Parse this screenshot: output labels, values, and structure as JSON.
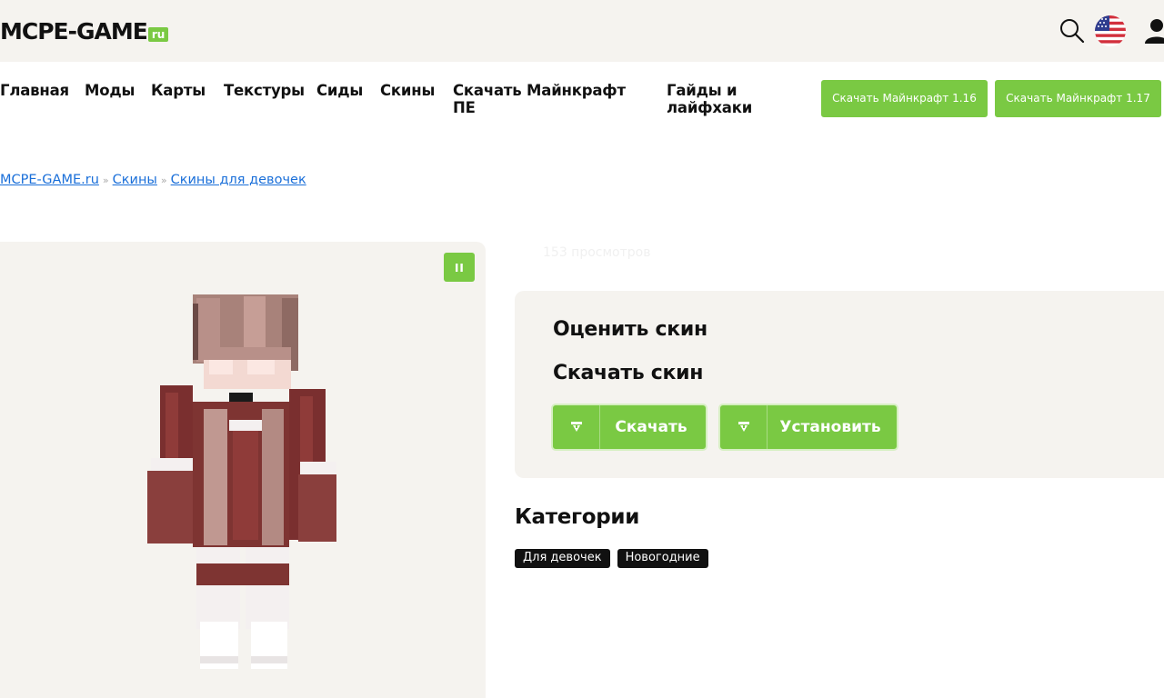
{
  "header": {
    "logo_main": "MCPE-GAME",
    "logo_suffix": "ru",
    "accent": "#7ac943"
  },
  "nav": {
    "items": [
      "Главная",
      "Моды",
      "Карты",
      "Текстуры",
      "Сиды",
      "Скины",
      "Скачать Майнкрафт ПЕ",
      "Гайды и лайфхаки"
    ],
    "cta_1": "Скачать Майнкрафт 1.16",
    "cta_2": "Скачать Майнкрафт 1.17"
  },
  "icons": {
    "search": "search-icon",
    "flag": "us-flag-icon",
    "user": "user-icon",
    "pause": "pause-icon",
    "download": "download-icon"
  },
  "breadcrumb": {
    "home": "MCPE-GAME.ru",
    "sep": "»",
    "skins": "Скины",
    "category": "Скины для девочек"
  },
  "skin": {
    "views": "153 просмотров"
  },
  "rate": {
    "title": "Оценить скин",
    "download_title": "Скачать скин",
    "download_button": "Скачать",
    "install_button": "Установить"
  },
  "categories": {
    "title": "Категории",
    "tags": [
      "Для девочек",
      "Новогодние"
    ]
  }
}
